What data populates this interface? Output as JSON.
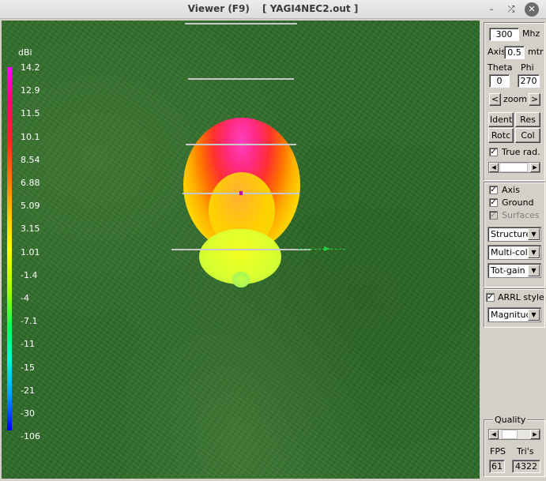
{
  "window": {
    "title": "Viewer (F9)",
    "filename": "[  YAGI4NEC2.out ]"
  },
  "scale": {
    "unit": "dBi",
    "labels": [
      "14.2",
      "12.9",
      "11.5",
      "10.1",
      "8.54",
      "6.88",
      "5.09",
      "3.15",
      "1.01",
      "-1.4",
      "-4",
      "-7.1",
      "-11",
      "-15",
      "-21",
      "-30",
      "-106"
    ]
  },
  "controls": {
    "frequency": "300",
    "frequency_unit": "Mhz",
    "axis_label": "Axis",
    "axis_value": "0.5",
    "axis_unit": "mtr",
    "theta_label": "Theta",
    "phi_label": "Phi",
    "theta_value": "0",
    "phi_value": "270",
    "zoom_label": "zoom",
    "zoom_left": "<",
    "zoom_right": ">",
    "buttons": {
      "ident": "Ident",
      "res": "Res",
      "rotc": "Rotc",
      "col": "Col"
    },
    "true_rad": "True rad.",
    "axis_check": "Axis",
    "ground_check": "Ground",
    "surfaces_check": "Surfaces",
    "structure_select": "Structure",
    "color_select": "Multi-color",
    "gain_select": "Tot-gain",
    "arrl_style": "ARRL style",
    "magnitude_select": "Magnitude",
    "quality_label": "Quality",
    "fps_label": "FPS",
    "tris_label": "Tri's",
    "fps_value": "61",
    "tris_value": "4322"
  }
}
